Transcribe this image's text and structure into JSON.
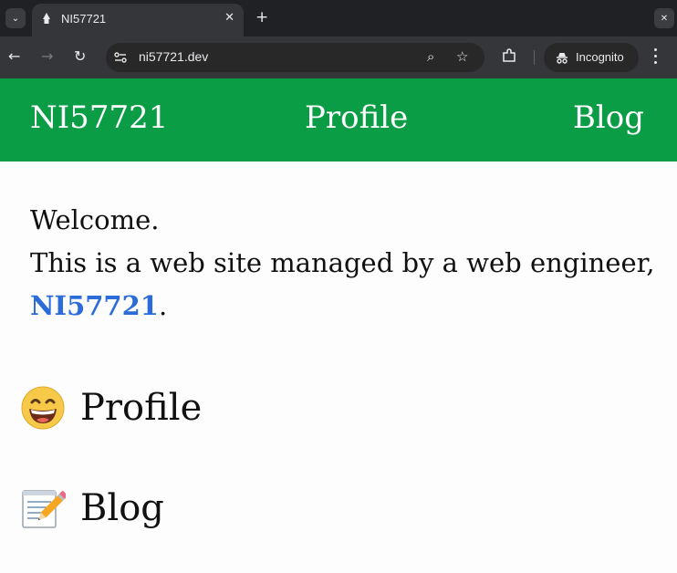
{
  "browser": {
    "tab_title": "NI57721",
    "url": "ni57721.dev",
    "incognito_label": "Incognito",
    "tab_menu_glyph": "⌄",
    "tab_close_glyph": "✕",
    "new_tab_glyph": "+",
    "window_glyph": "✕",
    "back_glyph": "←",
    "forward_glyph": "→",
    "reload_glyph": "↻",
    "zoom_glyph": "⌕",
    "star_glyph": "☆"
  },
  "site": {
    "brand": "NI57721",
    "nav": [
      {
        "label": "Profile"
      },
      {
        "label": "Blog"
      }
    ],
    "header_color": "#0a9d45",
    "link_color": "#2b6cd8"
  },
  "intro": {
    "line1": "Welcome.",
    "line2": "This is a web site managed by a web engineer,",
    "name": "NI57721",
    "period": "."
  },
  "sections": [
    {
      "title": "Profile",
      "icon": "grinning-face-icon"
    },
    {
      "title": "Blog",
      "icon": "memo-pencil-icon"
    }
  ]
}
